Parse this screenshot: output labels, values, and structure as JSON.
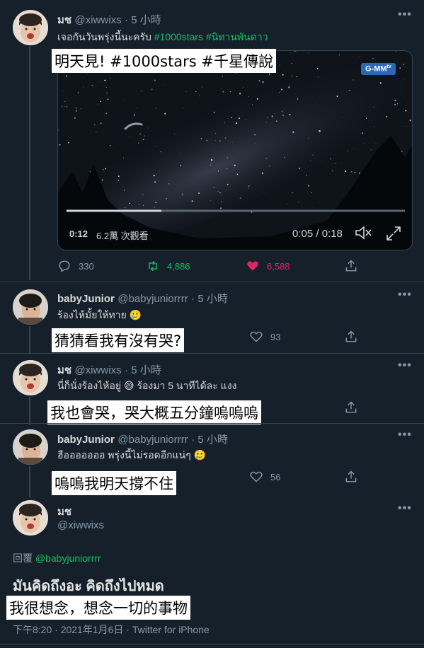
{
  "tweet1": {
    "name": "มช",
    "handle": "@xiwwixs",
    "time": "· 5 小時",
    "text": "เจอกันวันพรุ่งนี้นะครับ",
    "tag1": "#1000stars",
    "tag2": "#นิทานพันดาว",
    "caption": "明天見! #1000stars #千星傳說",
    "video": {
      "badge": "G-MM",
      "badge2": "tv",
      "duration": "0:12",
      "views": "6.2萬 次觀看",
      "time": "0:05 / 0:18",
      "progress": 0.28
    },
    "replies": "330",
    "retweets": "4,886",
    "likes": "6,588"
  },
  "reply1": {
    "name": "babyJunior",
    "handle": "@babyjuniorrrr",
    "time": "· 5 小時",
    "text": "ร้องไห้มั้ยให้ทาย 🥲",
    "caption": "猜猜看我有沒有哭?",
    "likes": "93"
  },
  "reply2": {
    "name": "มช",
    "handle": "@xiwwixs",
    "time": "· 5 小時",
    "text": "นี่ก็นั่งร้องไห้อยู่ 😅 ร้องมา 5 นาทีได้ละ แงง",
    "caption": "我也會哭，哭大概五分鐘嗚嗚嗚"
  },
  "reply3": {
    "name": "babyJunior",
    "handle": "@babyjuniorrrr",
    "time": "· 5 小時",
    "text": "ฮือออออออ พรุ่งนี้ไม่รอดอีกแน่ๆ 🥲",
    "caption": "嗚嗚我明天撐不住",
    "likes": "56"
  },
  "main": {
    "name": "มช",
    "handle": "@xiwwixs",
    "reply_to_label": "回覆",
    "reply_to": "@babyjuniorrrr",
    "text": "มันคิดถึงอะ คิดถึงไปหมด",
    "caption": "我很想念，想念一切的事物",
    "meta": "下午8:20 · 2021年1月6日 · Twitter for iPhone"
  },
  "colors": {
    "background": "#15202b",
    "retweet_green": "#17bf63",
    "like_red": "#e0245e",
    "muted": "#8899a6"
  }
}
